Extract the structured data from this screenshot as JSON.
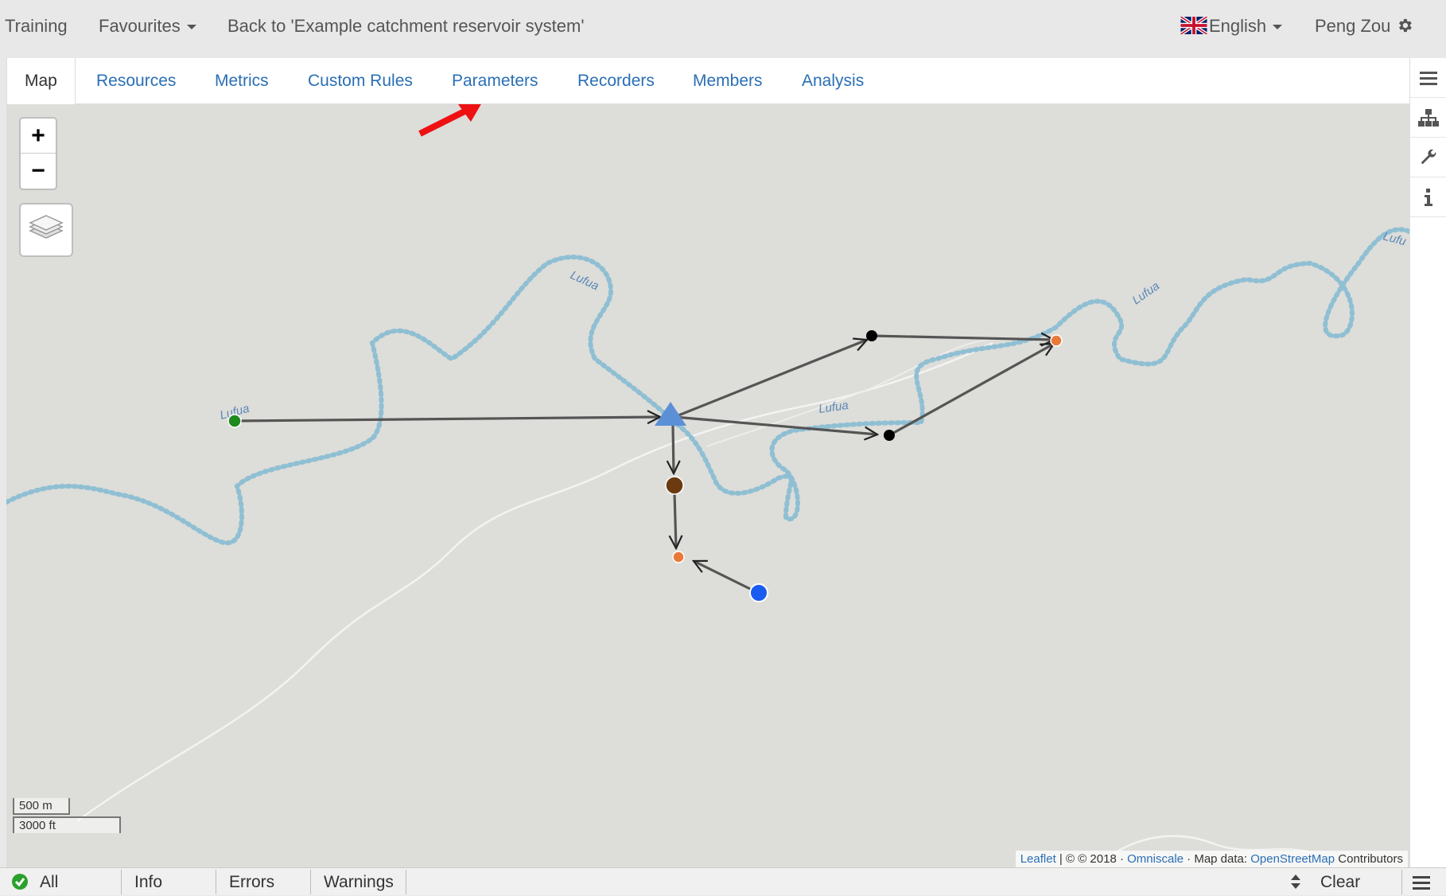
{
  "topbar": {
    "training": "Training",
    "favourites": "Favourites",
    "back_link": "Back to 'Example catchment reservoir system'",
    "language": "English",
    "user": "Peng Zou"
  },
  "tabs": [
    {
      "label": "Map",
      "active": true
    },
    {
      "label": "Resources"
    },
    {
      "label": "Metrics"
    },
    {
      "label": "Custom Rules"
    },
    {
      "label": "Parameters"
    },
    {
      "label": "Recorders"
    },
    {
      "label": "Members"
    },
    {
      "label": "Analysis"
    }
  ],
  "map": {
    "zoom_in": "+",
    "zoom_out": "−",
    "river_labels": [
      "Lufua",
      "Lufua",
      "Lufua",
      "Lufua",
      "Lufu"
    ],
    "scale_metric": "500 m",
    "scale_imperial": "3000 ft",
    "attribution": {
      "leaflet": "Leaflet",
      "sep1": " | © © 2018 · ",
      "omniscale": "Omniscale",
      "sep2": " · Map data: ",
      "osm": "OpenStreetMap",
      "suffix": " Contributors"
    },
    "colors": {
      "background": "#ddddd9",
      "river": "#8fbfd3",
      "edge": "#555555",
      "reservoir": "#5b8fd6",
      "catchment": "#1e8a1e",
      "link_node": "#000000",
      "output_node": "#e9793a",
      "demand_node": "#6b3a10",
      "input_node": "#1a5cf0",
      "annotation_arrow": "#ee1111"
    }
  },
  "sidebar_icons": [
    "menu-icon",
    "hierarchy-icon",
    "wrench-icon",
    "info-icon"
  ],
  "statusbar": {
    "all": "All",
    "info": "Info",
    "errors": "Errors",
    "warnings": "Warnings",
    "clear": "Clear"
  }
}
